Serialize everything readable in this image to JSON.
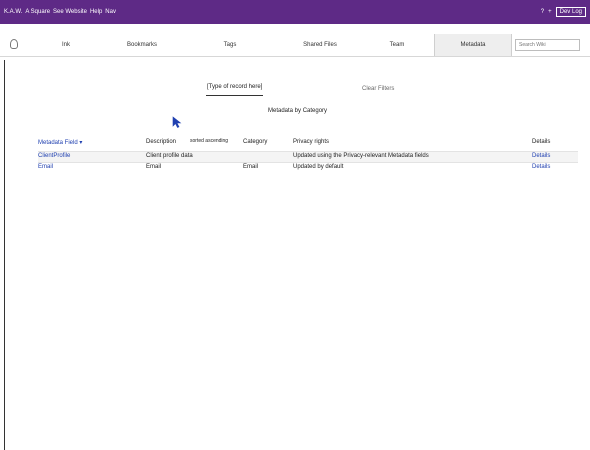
{
  "app": {
    "title_links": [
      "K.A.W.",
      "A Square",
      "See Website",
      "Help",
      "Nav"
    ],
    "right_links": [
      "?",
      "+"
    ],
    "user_box": "Dev Log",
    "accent": "#5e2a86"
  },
  "tabs": [
    {
      "label": "Ink"
    },
    {
      "label": "Bookmarks"
    },
    {
      "label": "Tags"
    },
    {
      "label": "Shared Files"
    },
    {
      "label": "Team"
    },
    {
      "label": "Metadata"
    }
  ],
  "search": {
    "placeholder": "Search Wiki"
  },
  "filter": {
    "select_value": "[Type of record here]",
    "clear_label": "Clear Filters",
    "subtitle": "Metadata by Category"
  },
  "table": {
    "headers": [
      "Metadata Field ▾",
      "Description",
      "Category",
      "Privacy rights",
      "Details"
    ],
    "header_note": "sorted ascending",
    "rows": [
      [
        "ClientProfile",
        "Client profile data",
        "",
        "Updated using the Privacy-relevant Metadata fields",
        "Details"
      ],
      [
        "Email",
        "Email",
        "Email",
        "Updated by default",
        "Details"
      ]
    ]
  }
}
